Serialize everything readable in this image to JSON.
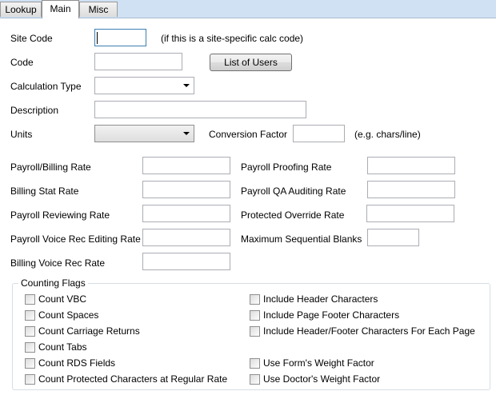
{
  "tabs": [
    {
      "label": "Lookup"
    },
    {
      "label": "Main"
    },
    {
      "label": "Misc"
    }
  ],
  "form": {
    "site_code": {
      "label": "Site Code",
      "value": "",
      "hint": "(if this is a site-specific calc code)"
    },
    "code": {
      "label": "Code",
      "value": ""
    },
    "list_users_button": "List of Users",
    "calc_type": {
      "label": "Calculation Type",
      "value": ""
    },
    "description": {
      "label": "Description",
      "value": ""
    },
    "units": {
      "label": "Units",
      "value": ""
    },
    "conversion_factor": {
      "label": "Conversion Factor",
      "value": "",
      "hint": "(e.g. chars/line)"
    }
  },
  "rates_left": [
    {
      "label": "Payroll/Billing Rate",
      "value": ""
    },
    {
      "label": "Billing Stat Rate",
      "value": ""
    },
    {
      "label": "Payroll Reviewing Rate",
      "value": ""
    },
    {
      "label": "Payroll Voice Rec Editing Rate",
      "value": ""
    },
    {
      "label": "Billing Voice Rec Rate",
      "value": ""
    }
  ],
  "rates_right": [
    {
      "label": "Payroll Proofing Rate",
      "value": ""
    },
    {
      "label": "Payroll QA Auditing Rate",
      "value": ""
    },
    {
      "label": "Protected Override Rate",
      "value": ""
    },
    {
      "label": "Maximum Sequential Blanks",
      "value": ""
    }
  ],
  "counting_flags": {
    "title": "Counting Flags",
    "left": [
      {
        "label": "Count VBC"
      },
      {
        "label": "Count Spaces"
      },
      {
        "label": "Count Carriage Returns"
      },
      {
        "label": "Count Tabs"
      },
      {
        "label": "Count RDS Fields"
      },
      {
        "label": "Count Protected Characters at Regular Rate"
      }
    ],
    "right": [
      {
        "label": "Include Header Characters"
      },
      {
        "label": "Include Page Footer Characters"
      },
      {
        "label": "Include Header/Footer Characters For Each Page"
      },
      {
        "label": "Use Form's Weight Factor"
      },
      {
        "label": "Use Doctor's Weight Factor"
      }
    ]
  }
}
